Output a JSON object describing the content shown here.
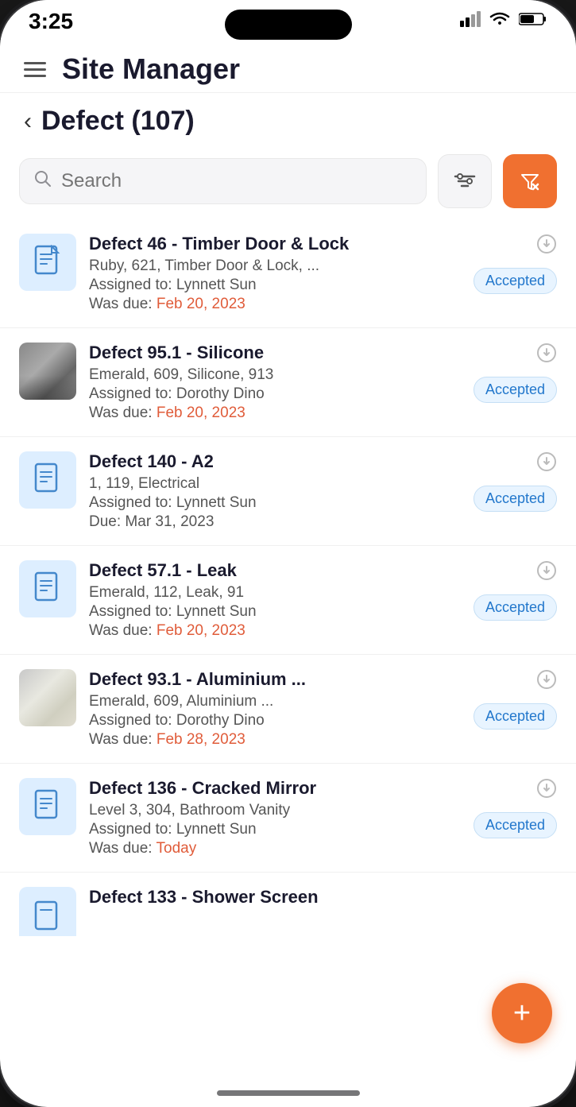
{
  "status_bar": {
    "time": "3:25",
    "battery": "49"
  },
  "header": {
    "menu_label": "Menu",
    "app_title": "Site Manager"
  },
  "page": {
    "back_label": "‹",
    "title": "Defect (107)"
  },
  "search": {
    "placeholder": "Search",
    "filter_label": "Filter",
    "filter_active_label": "Active Filter"
  },
  "defects": [
    {
      "id": "defect-1",
      "title": "Defect 46 - Timber Door & Lock",
      "subtitle": "Ruby, 621, Timber Door & Lock, ...",
      "assigned": "Assigned to: Lynnett Sun",
      "due_prefix": "Was due: ",
      "due_date": "Feb 20, 2023",
      "due_overdue": true,
      "status": "Accepted",
      "thumb_type": "blue-icon"
    },
    {
      "id": "defect-2",
      "title": "Defect 95.1 - Silicone",
      "subtitle": "Emerald, 609, Silicone, 913",
      "assigned": "Assigned to: Dorothy Dino",
      "due_prefix": "Was due: ",
      "due_date": "Feb 20, 2023",
      "due_overdue": true,
      "status": "Accepted",
      "thumb_type": "silicone-photo"
    },
    {
      "id": "defect-3",
      "title": "Defect 140 - A2",
      "subtitle": "1, 119, Electrical",
      "assigned": "Assigned to: Lynnett Sun",
      "due_prefix": "Due: ",
      "due_date": "Mar 31, 2023",
      "due_overdue": false,
      "status": "Accepted",
      "thumb_type": "blue-icon"
    },
    {
      "id": "defect-4",
      "title": "Defect 57.1 - Leak",
      "subtitle": "Emerald, 112, Leak, 91",
      "assigned": "Assigned to: Lynnett Sun",
      "due_prefix": "Was due: ",
      "due_date": "Feb 20, 2023",
      "due_overdue": true,
      "status": "Accepted",
      "thumb_type": "blue-icon"
    },
    {
      "id": "defect-5",
      "title": "Defect 93.1 - Aluminium ...",
      "subtitle": "Emerald, 609, Aluminium ...",
      "assigned": "Assigned to: Dorothy Dino",
      "due_prefix": "Was due: ",
      "due_date": "Feb 28, 2023",
      "due_overdue": true,
      "status": "Accepted",
      "thumb_type": "aluminium-photo"
    },
    {
      "id": "defect-6",
      "title": "Defect 136 - Cracked Mirror",
      "subtitle": "Level 3, 304, Bathroom Vanity",
      "assigned": "Assigned to: Lynnett Sun",
      "due_prefix": "Was due: ",
      "due_date": "Today",
      "due_overdue": true,
      "status": "Accepted",
      "thumb_type": "blue-icon"
    },
    {
      "id": "defect-7",
      "title": "Defect 133 - Shower Screen",
      "subtitle": "",
      "assigned": "",
      "due_prefix": "",
      "due_date": "",
      "due_overdue": false,
      "status": "",
      "thumb_type": "blue-icon"
    }
  ],
  "fab": {
    "label": "+"
  }
}
